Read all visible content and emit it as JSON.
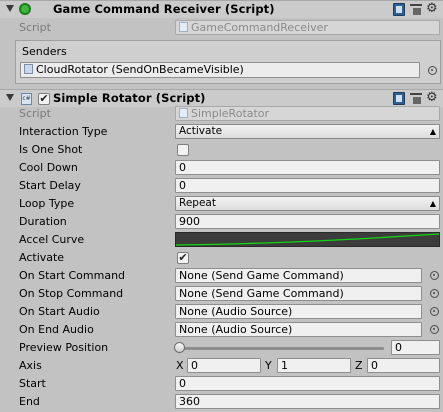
{
  "component1": {
    "title": "Game Command Receiver (Script)",
    "script_label": "Script",
    "script_value": "GameCommandReceiver",
    "senders_label": "Senders",
    "senders_item": "CloudRotator (SendOnBecameVisible)"
  },
  "component2": {
    "title": "Simple Rotator (Script)",
    "enabled": true,
    "script_label": "Script",
    "script_value": "SimpleRotator",
    "interaction_type": {
      "label": "Interaction Type",
      "value": "Activate"
    },
    "is_one_shot": {
      "label": "Is One Shot",
      "checked": false
    },
    "cool_down": {
      "label": "Cool Down",
      "value": "0"
    },
    "start_delay": {
      "label": "Start Delay",
      "value": "0"
    },
    "loop_type": {
      "label": "Loop Type",
      "value": "Repeat"
    },
    "duration": {
      "label": "Duration",
      "value": "900"
    },
    "accel_curve": {
      "label": "Accel Curve",
      "curve_color": "#14d414"
    },
    "activate": {
      "label": "Activate",
      "checked": true
    },
    "on_start_command": {
      "label": "On Start Command",
      "value": "None (Send Game Command)"
    },
    "on_stop_command": {
      "label": "On Stop Command",
      "value": "None (Send Game Command)"
    },
    "on_start_audio": {
      "label": "On Start Audio",
      "value": "None (Audio Source)"
    },
    "on_end_audio": {
      "label": "On End Audio",
      "value": "None (Audio Source)"
    },
    "preview_position": {
      "label": "Preview Position",
      "value": "0"
    },
    "axis": {
      "label": "Axis",
      "x_label": "X",
      "x": "0",
      "y_label": "Y",
      "y": "1",
      "z_label": "Z",
      "z": "0"
    },
    "start": {
      "label": "Start",
      "value": "0"
    },
    "end": {
      "label": "End",
      "value": "360"
    }
  },
  "colors": {
    "header_bg": "#cbcbcb",
    "panel_bg": "#c2c2c2",
    "go_icon": "#3db83d"
  },
  "icons": [
    "foldout-arrow-icon",
    "gameobject-icon",
    "script-icon",
    "help-book-icon",
    "preset-icon",
    "gear-icon",
    "object-picker-icon"
  ]
}
